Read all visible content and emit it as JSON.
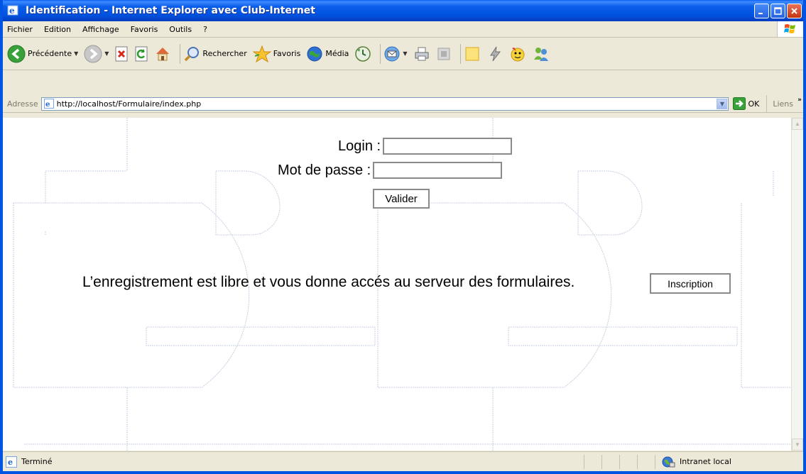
{
  "window": {
    "title": "Identification - Internet Explorer avec Club-Internet"
  },
  "menu": {
    "items": [
      "Fichier",
      "Edition",
      "Affichage",
      "Favoris",
      "Outils",
      "?"
    ]
  },
  "toolbar": {
    "back_label": "Précédente",
    "search_label": "Rechercher",
    "favorites_label": "Favoris",
    "media_label": "Média"
  },
  "address": {
    "label": "Adresse",
    "url": "http://localhost/Formulaire/index.php",
    "go_label": "OK",
    "links_label": "Liens"
  },
  "page": {
    "login_label": "Login :",
    "login_value": "",
    "password_label": "Mot de passe :",
    "password_value": "",
    "submit_label": "Valider",
    "info_text": "L’enregistrement est libre et vous donne accés au serveur des formulaires.",
    "register_label": "Inscription"
  },
  "status": {
    "text": "Terminé",
    "zone": "Intranet local"
  },
  "colors": {
    "titlebar": "#0054e3",
    "chrome": "#ece9d8",
    "field_border": "#8a8a8a",
    "background_drawing": "#c7cfe3"
  }
}
